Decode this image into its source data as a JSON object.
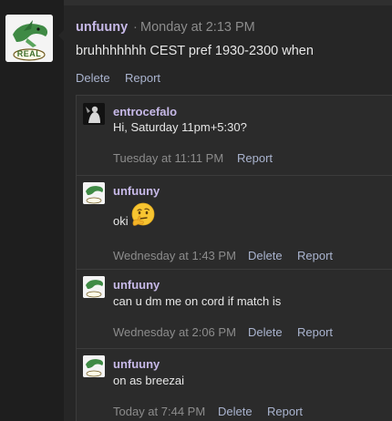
{
  "thread": {
    "main_post": {
      "author": "unfuuny",
      "separator": "·",
      "time": "Monday at 2:13 PM",
      "body": "bruhhhhhhh CEST pref 1930-2300 when",
      "actions": {
        "delete": "Delete",
        "report": "Report"
      }
    },
    "replies": [
      {
        "author": "entrocefalo",
        "body": "Hi, Saturday 11pm+5:30?",
        "time": "Tuesday at 11:11 PM",
        "actions": {
          "report": "Report"
        }
      },
      {
        "author": "unfuuny",
        "body": "oki",
        "emoji": "thinking-face-emoji",
        "time": "Wednesday at 1:43 PM",
        "actions": {
          "delete": "Delete",
          "report": "Report"
        }
      },
      {
        "author": "unfuuny",
        "body": "can u dm me on cord if match is",
        "time": "Wednesday at 2:06 PM",
        "actions": {
          "delete": "Delete",
          "report": "Report"
        }
      },
      {
        "author": "unfuuny",
        "body": "on as breezai",
        "time": "Today at 7:44 PM",
        "actions": {
          "delete": "Delete",
          "report": "Report"
        }
      }
    ]
  },
  "avatar_logo_text": "REAL",
  "colors": {
    "author": "#c7b9e8",
    "link": "#aab4cf",
    "muted": "#8c8c8c",
    "text": "#e6e6e6",
    "panel": "#2b2b2b",
    "background": "#1c1c1c"
  }
}
